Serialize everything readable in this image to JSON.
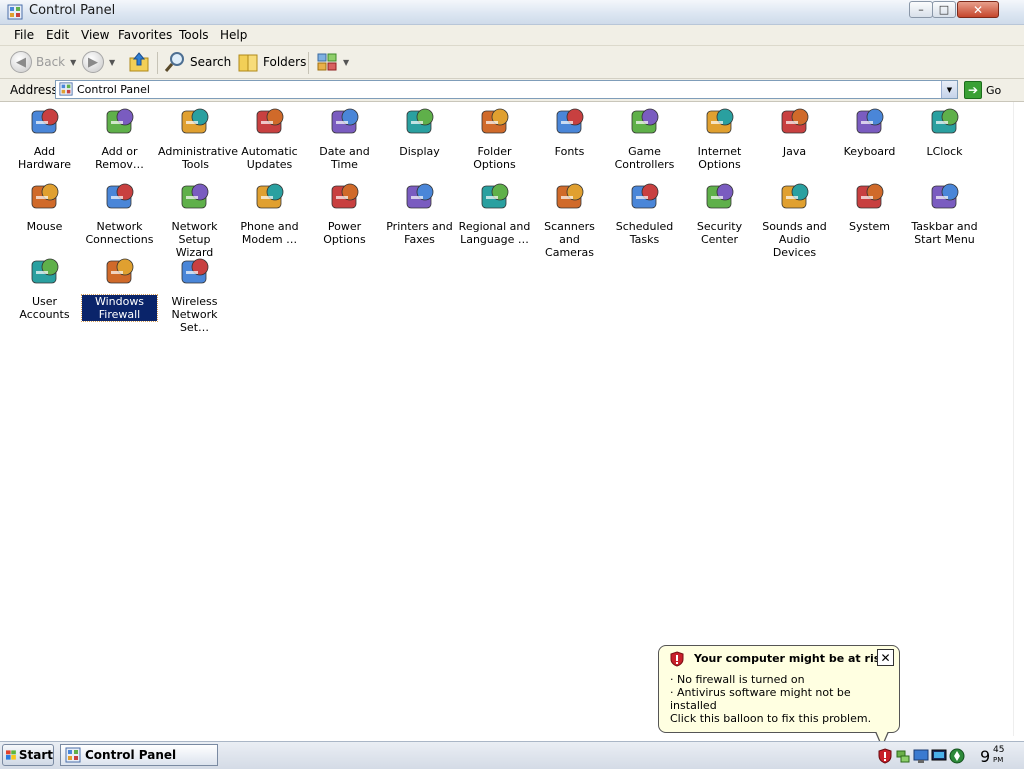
{
  "window": {
    "title": "Control Panel",
    "buttons": {
      "minimize": "–",
      "maximize": "□",
      "close": "✕"
    }
  },
  "menu": [
    "File",
    "Edit",
    "View",
    "Favorites",
    "Tools",
    "Help"
  ],
  "toolbar": {
    "back": "Back",
    "search": "Search",
    "folders": "Folders"
  },
  "address": {
    "label": "Address",
    "value": "Control Panel",
    "go": "Go"
  },
  "items": [
    {
      "label": "Add Hardware",
      "icon": "add-hardware-icon"
    },
    {
      "label": "Add or Remov…",
      "icon": "add-remove-programs-icon"
    },
    {
      "label": "Administrative Tools",
      "icon": "administrative-tools-icon"
    },
    {
      "label": "Automatic Updates",
      "icon": "automatic-updates-icon"
    },
    {
      "label": "Date and Time",
      "icon": "date-time-icon"
    },
    {
      "label": "Display",
      "icon": "display-icon"
    },
    {
      "label": "Folder Options",
      "icon": "folder-options-icon"
    },
    {
      "label": "Fonts",
      "icon": "fonts-icon"
    },
    {
      "label": "Game Controllers",
      "icon": "game-controllers-icon"
    },
    {
      "label": "Internet Options",
      "icon": "internet-options-icon"
    },
    {
      "label": "Java",
      "icon": "java-icon"
    },
    {
      "label": "Keyboard",
      "icon": "keyboard-icon"
    },
    {
      "label": "LClock",
      "icon": "lclock-icon"
    },
    {
      "label": "Mouse",
      "icon": "mouse-icon"
    },
    {
      "label": "Network Connections",
      "icon": "network-connections-icon"
    },
    {
      "label": "Network Setup Wizard",
      "icon": "network-setup-wizard-icon"
    },
    {
      "label": "Phone and Modem …",
      "icon": "phone-modem-icon"
    },
    {
      "label": "Power Options",
      "icon": "power-options-icon"
    },
    {
      "label": "Printers and Faxes",
      "icon": "printers-faxes-icon"
    },
    {
      "label": "Regional and Language …",
      "icon": "regional-language-icon"
    },
    {
      "label": "Scanners and Cameras",
      "icon": "scanners-cameras-icon"
    },
    {
      "label": "Scheduled Tasks",
      "icon": "scheduled-tasks-icon"
    },
    {
      "label": "Security Center",
      "icon": "security-center-icon"
    },
    {
      "label": "Sounds and Audio Devices",
      "icon": "sounds-audio-icon"
    },
    {
      "label": "System",
      "icon": "system-icon"
    },
    {
      "label": "Taskbar and Start Menu",
      "icon": "taskbar-start-menu-icon"
    },
    {
      "label": "User Accounts",
      "icon": "user-accounts-icon"
    },
    {
      "label": "Windows Firewall",
      "icon": "windows-firewall-icon",
      "selected": true
    },
    {
      "label": "Wireless Network Set…",
      "icon": "wireless-network-icon"
    }
  ],
  "balloon": {
    "title": "Your computer might be at risk",
    "lines": [
      "· No firewall is turned on",
      "· Antivirus software might not be installed"
    ],
    "action": "Click this balloon to fix this problem.",
    "close": "✕"
  },
  "taskbar": {
    "start": "Start",
    "task": "Control Panel",
    "clock": {
      "hour": "9",
      "minute": "45",
      "period": "PM"
    }
  }
}
